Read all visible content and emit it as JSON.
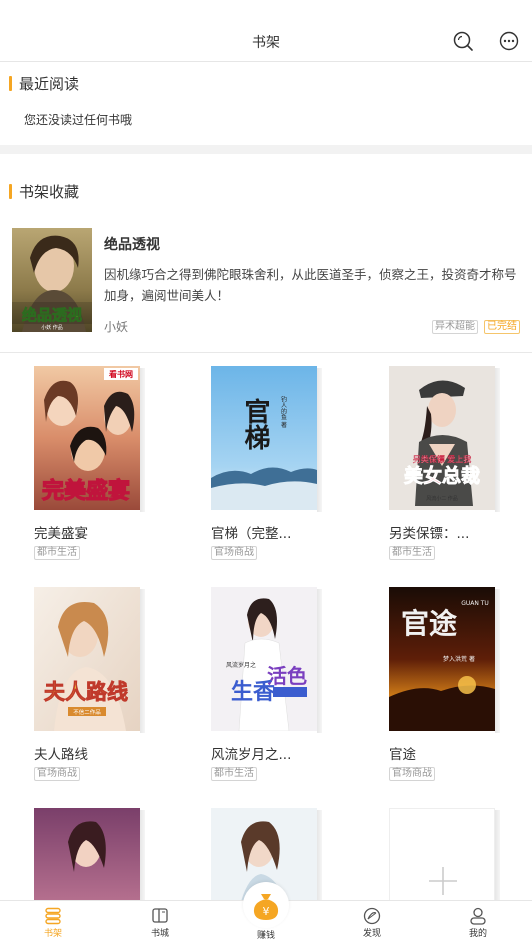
{
  "header": {
    "title": "书架"
  },
  "recent": {
    "title": "最近阅读",
    "empty_text": "您还没读过任何书哦"
  },
  "shelf": {
    "title": "书架收藏"
  },
  "featured": {
    "name": "绝品透视",
    "description": "因机缘巧合之得到佛陀眼珠舍利，从此医道圣手，侦察之王，投资奇才称号加身，遍阅世间美人！",
    "author": "小妖",
    "genre_tag": "异术超能",
    "status_tag": "已完结",
    "cover_text": "绝品透视",
    "cover_sub": "小妖 作品"
  },
  "books": [
    {
      "name": "完美盛宴",
      "tag": "都市生活",
      "cover_text": "完美盛宴",
      "cover_badge": "看书网"
    },
    {
      "name": "官梯（完整...",
      "tag": "官场商战",
      "cover_text": "官梯",
      "cover_sub": "钓人的鱼 著"
    },
    {
      "name": "另类保镖：...",
      "tag": "都市生活",
      "cover_text": "美女总裁",
      "cover_sub": "另类保镖 爱上我",
      "cover_author": "风流小二 作品"
    },
    {
      "name": "夫人路线",
      "tag": "官场商战",
      "cover_text": "夫人路线",
      "cover_sub": "不信二作品"
    },
    {
      "name": "风流岁月之...",
      "tag": "都市生活",
      "cover_text": "生香",
      "cover_big": "活色",
      "cover_sub": "风流岁月之"
    },
    {
      "name": "官途",
      "tag": "官场商战",
      "cover_text": "官途",
      "cover_latin": "GUAN TU",
      "cover_sub": "梦入洪荒 著"
    }
  ],
  "bottom_nav": [
    {
      "label": "书架",
      "active": true
    },
    {
      "label": "书城",
      "active": false
    },
    {
      "label": "赚钱",
      "active": false
    },
    {
      "label": "发现",
      "active": false
    },
    {
      "label": "我的",
      "active": false
    }
  ],
  "colors": {
    "accent": "#f5a623",
    "divider": "#e6e6e6",
    "band": "#f2f2f2"
  },
  "icons": {
    "search": "search-icon",
    "more": "more-icon",
    "add": "add-icon"
  }
}
